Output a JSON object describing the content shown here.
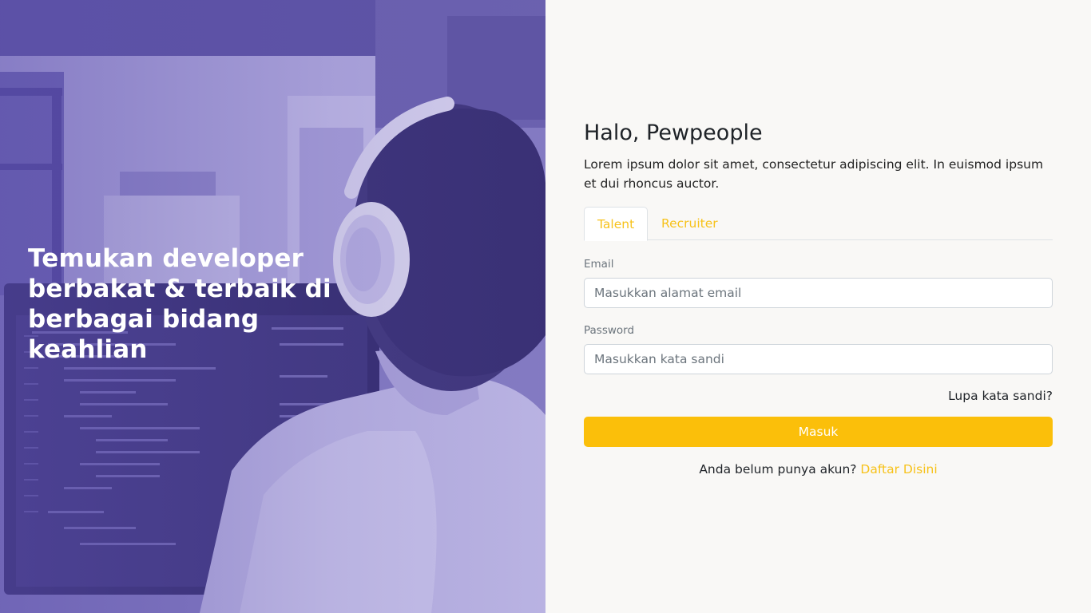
{
  "hero": {
    "headline": "Temukan developer berbakat & terbaik di berbagai bidang keahlian"
  },
  "login": {
    "greeting": "Halo, Pewpeople",
    "description": "Lorem ipsum dolor sit amet, consectetur adipiscing elit. In euismod ipsum et dui rhoncus auctor.",
    "tabs": [
      {
        "label": "Talent",
        "active": true
      },
      {
        "label": "Recruiter",
        "active": false
      }
    ],
    "email": {
      "label": "Email",
      "placeholder": "Masukkan alamat email",
      "value": ""
    },
    "password": {
      "label": "Password",
      "placeholder": "Masukkan kata sandi",
      "value": ""
    },
    "forgot_label": "Lupa kata sandi?",
    "submit_label": "Masuk",
    "signup_prompt": "Anda belum punya akun?",
    "signup_link": "Daftar Disini"
  },
  "colors": {
    "accent": "#fbbf0a",
    "hero_overlay": "#7d74bd",
    "panel_bg": "#f9f8f6"
  }
}
